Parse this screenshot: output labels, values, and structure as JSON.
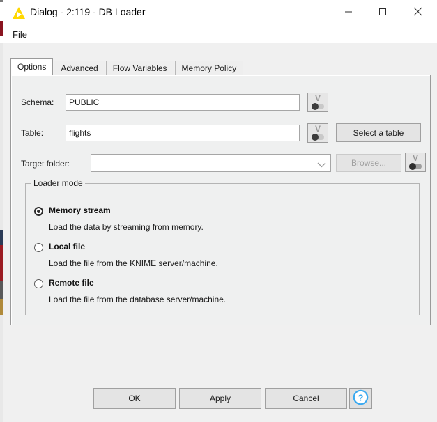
{
  "window": {
    "title": "Dialog - 2:119 - DB Loader",
    "icon": "knime-triangle-icon",
    "controls": {
      "minimize": "minimize-icon",
      "maximize": "maximize-icon",
      "close": "close-icon"
    }
  },
  "menubar": {
    "items": [
      {
        "label": "File"
      }
    ]
  },
  "tabs": [
    {
      "label": "Options",
      "selected": true
    },
    {
      "label": "Advanced",
      "selected": false
    },
    {
      "label": "Flow Variables",
      "selected": false
    },
    {
      "label": "Memory Policy",
      "selected": false
    }
  ],
  "form": {
    "schema": {
      "label": "Schema:",
      "value": "PUBLIC",
      "placeholder": "",
      "flow_variable_button": "flow-variable-icon"
    },
    "table": {
      "label": "Table:",
      "value": "flights",
      "placeholder": "",
      "flow_variable_button": "flow-variable-icon",
      "select_button": "Select a table"
    },
    "target_folder": {
      "label": "Target folder:",
      "value": "",
      "placeholder": "",
      "dropdown_icon": "chevron-down-icon",
      "browse_button": "Browse...",
      "browse_disabled": true,
      "flow_variable_button": "flow-variable-icon"
    }
  },
  "loader_mode": {
    "group_title": "Loader mode",
    "options": [
      {
        "label": "Memory stream",
        "description": "Load the data by streaming from memory.",
        "selected": true
      },
      {
        "label": "Local file",
        "description": "Load the file from the KNIME server/machine.",
        "selected": false
      },
      {
        "label": "Remote file",
        "description": "Load the file from the database server/machine.",
        "selected": false
      }
    ]
  },
  "footer": {
    "ok": "OK",
    "apply": "Apply",
    "cancel": "Cancel",
    "help_icon": "help-question-icon"
  },
  "colors": {
    "knime_yellow": "#ffd800",
    "help_blue": "#3aa9f0",
    "panel_bg": "#eff0f0",
    "dialog_bg": "#f0f0f0",
    "titlebar_bg": "#ffffff"
  }
}
